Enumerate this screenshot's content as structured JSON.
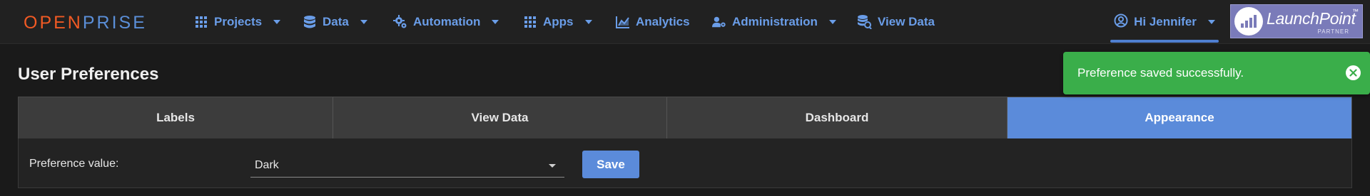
{
  "brand": {
    "part1": "OPEN",
    "part2": "PRISE"
  },
  "nav": {
    "projects": "Projects",
    "data": "Data",
    "automation": "Automation",
    "apps": "Apps",
    "analytics": "Analytics",
    "administration": "Administration",
    "view_data": "View Data",
    "user": "Hi Jennifer"
  },
  "partner": {
    "name": "LaunchPoint",
    "tag": "PARTNER",
    "tm": "™"
  },
  "page": {
    "title": "User Preferences"
  },
  "tabs": [
    {
      "label": "Labels"
    },
    {
      "label": "View Data"
    },
    {
      "label": "Dashboard"
    },
    {
      "label": "Appearance",
      "active": true
    }
  ],
  "preference": {
    "label": "Preference value:",
    "value": "Dark",
    "save_label": "Save"
  },
  "toast": {
    "message": "Preference saved successfully."
  },
  "colors": {
    "accent": "#5b8bda",
    "success": "#3aae4a",
    "brand_orange": "#f15a24"
  }
}
